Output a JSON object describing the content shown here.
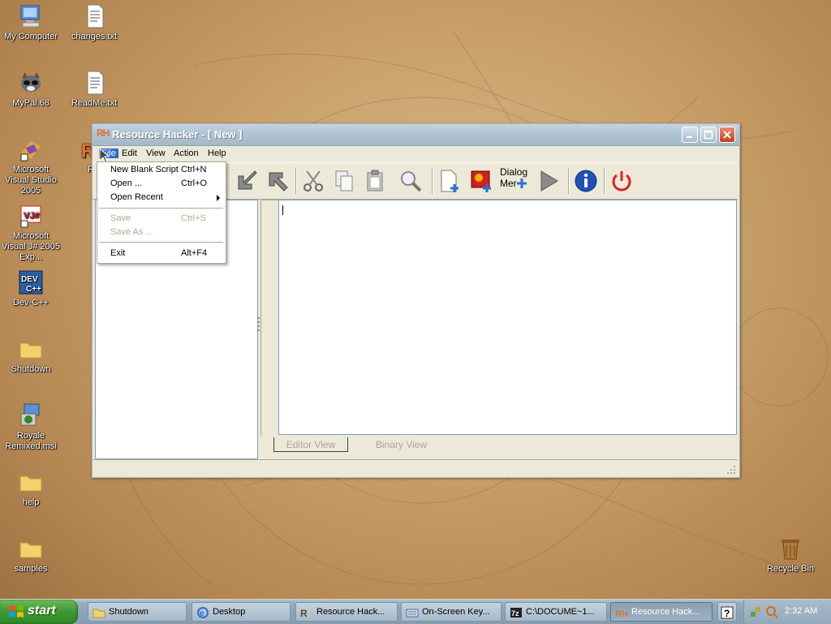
{
  "desktop": {
    "icons": [
      {
        "label": "My Computer"
      },
      {
        "label": "changes.txt"
      },
      {
        "label": "MyPal.68"
      },
      {
        "label": "ReadMe.txt"
      },
      {
        "label": "Microsoft Visual Studio 2005"
      },
      {
        "label": "Resou"
      },
      {
        "label": "Microsoft Visual J# 2005 Exp..."
      },
      {
        "label": "Dev-C++"
      },
      {
        "label": "Shutdown"
      },
      {
        "label": "Royale Remixed.msi"
      },
      {
        "label": "help"
      },
      {
        "label": "samples"
      },
      {
        "label": "Recycle Bin"
      }
    ]
  },
  "window": {
    "app_icon_text": "RH",
    "title": "Resource Hacker - [ New ]",
    "menu": [
      "File",
      "Edit",
      "View",
      "Action",
      "Help"
    ],
    "toolbar": {
      "dialog_merge_label_1": "Dialog",
      "dialog_merge_label_2": "Mer"
    },
    "view_tabs": [
      "Editor View",
      "Binary View"
    ]
  },
  "file_menu": {
    "items": [
      {
        "label": "New Blank Script",
        "shortcut": "Ctrl+N"
      },
      {
        "label": "Open ...",
        "shortcut": "Ctrl+O"
      },
      {
        "label": "Open Recent",
        "shortcut": ""
      },
      {
        "label": "Save",
        "shortcut": "Ctrl+S"
      },
      {
        "label": "Save As ...",
        "shortcut": ""
      },
      {
        "label": "Exit",
        "shortcut": "Alt+F4"
      }
    ]
  },
  "taskbar": {
    "start_label": "start",
    "tasks": [
      {
        "label": "Shutdown"
      },
      {
        "label": "Desktop"
      },
      {
        "label": "Resource Hack..."
      },
      {
        "label": "On-Screen Key..."
      },
      {
        "label": "C:\\DOCUME~1..."
      },
      {
        "label": "Resource Hack..."
      }
    ],
    "clock": "2:32 AM"
  }
}
